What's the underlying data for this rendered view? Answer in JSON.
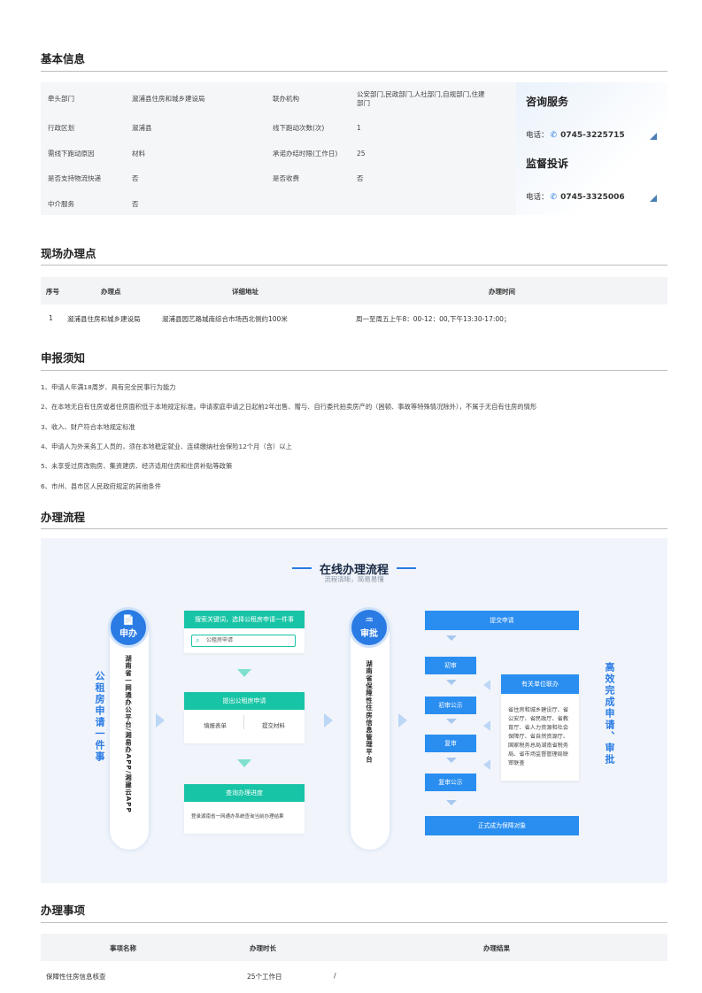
{
  "basic": {
    "title": "基本信息",
    "rows": [
      {
        "l1": "牵头部门",
        "v1": "溆浦县住房和城乡建设局",
        "l2": "联办机构",
        "v2": "公安部门,民政部门,人社部门,自规部门,住建部门"
      },
      {
        "l1": "行政区划",
        "v1": "溆浦县",
        "l2": "线下跑动次数(次)",
        "v2": "1"
      },
      {
        "l1": "需线下跑动原因",
        "v1": "材料",
        "l2": "承诺办结时限(工作日)",
        "v2": "25"
      },
      {
        "l1": "是否支持物流快递",
        "v1": "否",
        "l2": "是否收费",
        "v2": "否"
      },
      {
        "l1": "中介服务",
        "v1": "否",
        "l2": "",
        "v2": ""
      }
    ]
  },
  "contact": {
    "consult_title": "咨询服务",
    "consult_label": "电话：",
    "consult_phone": "0745-3225715",
    "supervise_title": "监督投诉",
    "supervise_label": "电话：",
    "supervise_phone": "0745-3325006",
    "phone_icon": "phone-icon",
    "accent": "#2a7be4"
  },
  "site": {
    "title": "现场办理点",
    "headers": [
      "序号",
      "办理点",
      "详细地址",
      "办理时间"
    ],
    "rows": [
      {
        "no": "1",
        "place": "溆浦县住房和城乡建设局",
        "addr": "溆浦县园艺路城南综合市场西北侧约100米",
        "time": "周一至周五上午8：00-12：00,下午13:30-17:00；"
      }
    ]
  },
  "notice": {
    "title": "申报须知",
    "items": [
      "1、申请人年满18周岁、具有完全民事行为能力",
      "2、在本地无自有住房或者住房面积低于本地规定标准。申请家庭申请之日起前2年出售、赠与、自行委托拍卖房产的（困顿、事故等特殊情况除外），不属于无自有住房的情形",
      "3、收入、财产符合本地规定标准",
      "4、申请人为外来务工人员的，须在本地稳定就业、连续缴纳社会保险12个月（含）以上",
      "5、未享受过房改购房、集资建房、经济适用住房和住房补贴等政策",
      "6、市州、县市区人民政府规定的其他条件"
    ]
  },
  "flow": {
    "title": "办理流程",
    "diagram_title": "在线办理流程",
    "diagram_sub": "流程清晰，简易易懂",
    "left_side": "公租房申请一件事",
    "apply_circle": "申办",
    "apply_vertical": "湖南省一网通办公平台/湘易办APP/湘建云APP",
    "card1_hd": "搜索关键词，选择公租房申请一件事",
    "card1_search": "公租房申请",
    "card2_hd": "提出公租房申请",
    "card2_a": "填报表单",
    "card2_b": "提交材料",
    "card3_hd": "查询办理进度",
    "card3_txt": "登录湖南省一网通办系统查询当前办理结果",
    "review_circle": "审批",
    "review_vertical": "湖南省保障性住房信息管理平台",
    "steps": [
      "提交申请",
      "初审",
      "初审公示",
      "复审",
      "复审公示",
      "正式成为保障对象"
    ],
    "unit_hd": "有关单位联办",
    "unit_txt": "省住房和城乡建设厅、省公安厅、省民政厅、省教育厅、省人力资源和社会保障厅、省自然资源厅、国家税务总局湖南省税务局、省市场监督管理局联审联查",
    "right_side": "高效完成申请、审批"
  },
  "items": {
    "title": "办理事项",
    "headers": [
      "事项名称",
      "办理时长",
      "办理结果"
    ],
    "rows": [
      {
        "name": "保障性住房信息核查",
        "dur": "25个工作日",
        "res": "/"
      }
    ]
  }
}
